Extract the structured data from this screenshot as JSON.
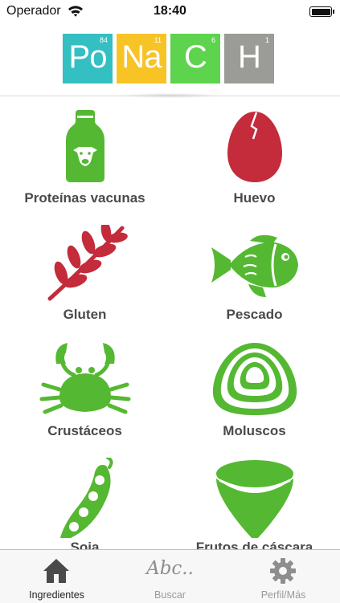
{
  "status_bar": {
    "carrier": "Operador",
    "time": "18:40"
  },
  "logo": {
    "tiles": [
      {
        "symbol": "Po",
        "number": "84",
        "color": "#34bfc2"
      },
      {
        "symbol": "Na",
        "number": "11",
        "color": "#f7c325"
      },
      {
        "symbol": "C",
        "number": "6",
        "color": "#5ed34e"
      },
      {
        "symbol": "H",
        "number": "1",
        "color": "#9b9b97"
      }
    ]
  },
  "colors": {
    "green": "#55b832",
    "red": "#c42b3b",
    "text": "#4a4a4a"
  },
  "grid": {
    "items": [
      {
        "label": "Proteínas vacunas",
        "icon": "cow-bottle-icon"
      },
      {
        "label": "Huevo",
        "icon": "egg-icon"
      },
      {
        "label": "Gluten",
        "icon": "wheat-icon"
      },
      {
        "label": "Pescado",
        "icon": "fish-icon"
      },
      {
        "label": "Crustáceos",
        "icon": "crab-icon"
      },
      {
        "label": "Moluscos",
        "icon": "clam-icon"
      },
      {
        "label": "Soja",
        "icon": "soy-pod-icon"
      },
      {
        "label": "Frutos de cáscara",
        "icon": "nut-icon"
      }
    ]
  },
  "tabbar": {
    "tabs": [
      {
        "label": "Ingredientes",
        "icon": "house-icon",
        "active": true
      },
      {
        "label": "Buscar",
        "icon": "abc-text-icon",
        "glyph": "Abc..",
        "active": false
      },
      {
        "label": "Perfil/Más",
        "icon": "gear-icon",
        "active": false
      }
    ]
  }
}
